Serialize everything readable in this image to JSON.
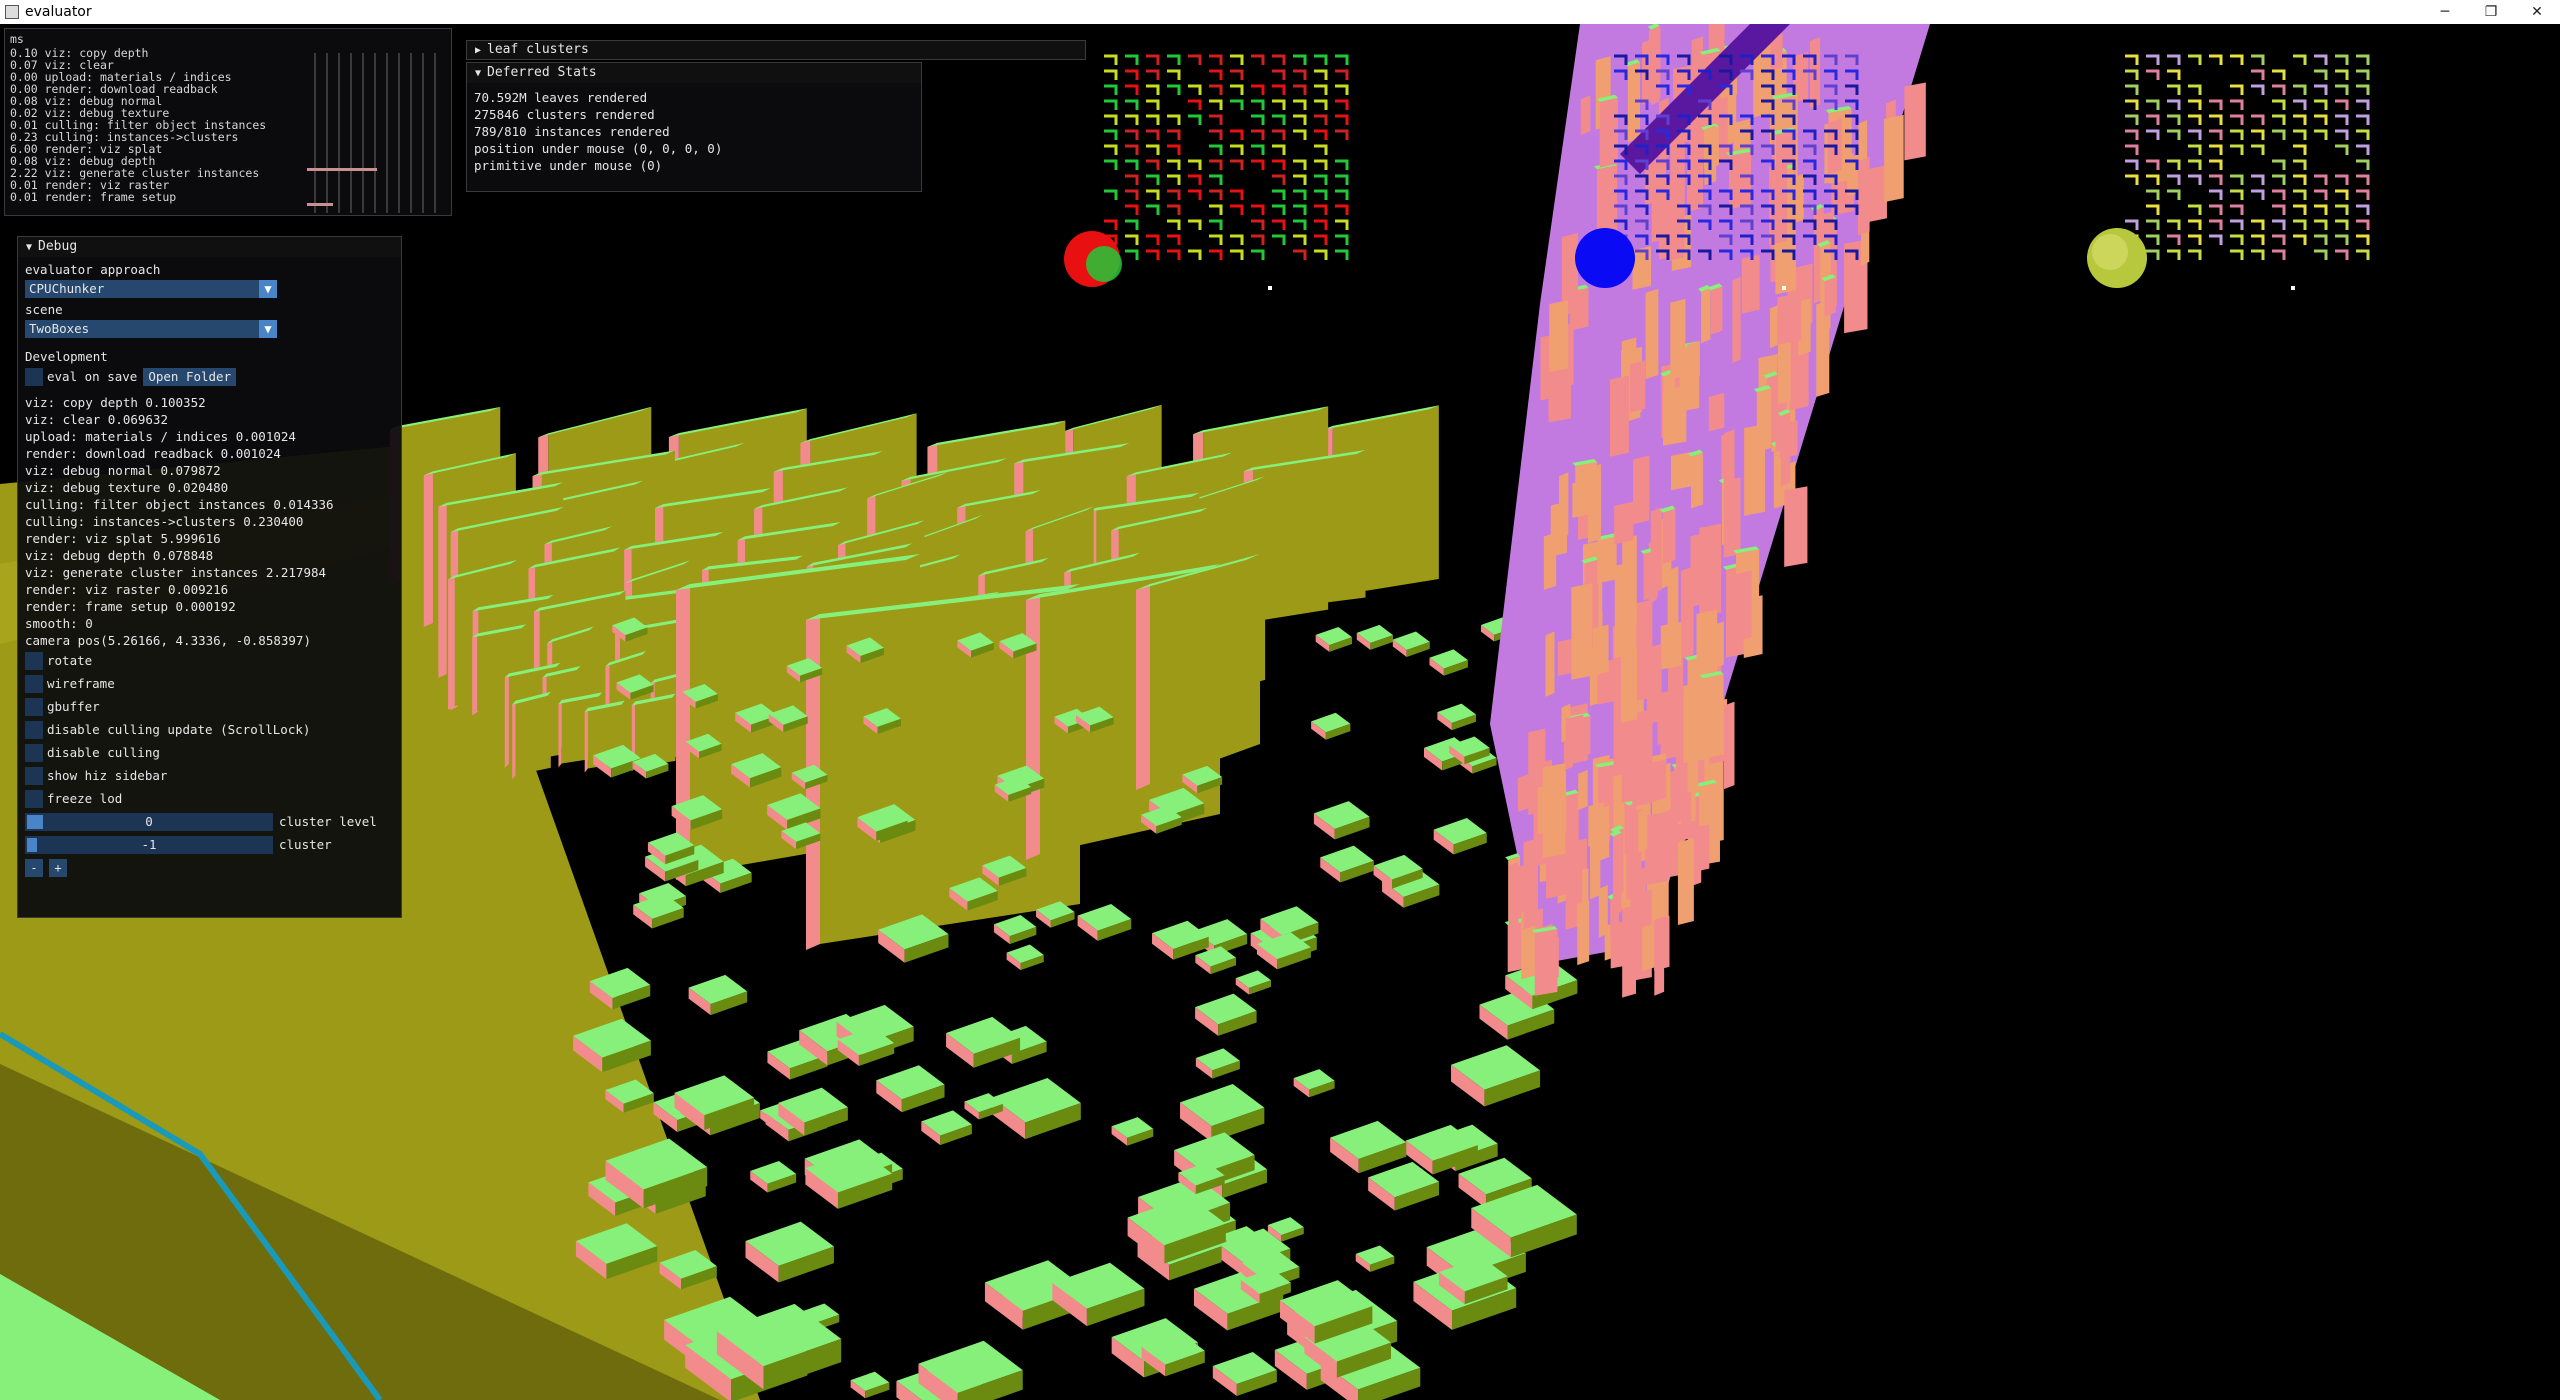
{
  "window": {
    "title": "evaluator",
    "minimize": "─",
    "maximize": "❐",
    "close": "✕"
  },
  "timing_panel": {
    "header": "ms",
    "lines": [
      "0.10 viz: copy depth",
      "0.07 viz: clear",
      "0.00 upload: materials / indices",
      "0.00 render: download readback",
      "0.08 viz: debug normal",
      "0.02 viz: debug texture",
      "0.01 culling: filter object instances",
      "0.23 culling: instances->clusters",
      "6.00 render: viz splat",
      "0.08 viz: debug depth",
      "2.22 viz: generate cluster instances",
      "0.01 render: viz raster",
      "0.01 render: frame setup"
    ]
  },
  "leaf_clusters": {
    "title": "leaf clusters"
  },
  "deferred_stats": {
    "title": "Deferred Stats",
    "lines": [
      "70.592M leaves rendered",
      "275846 clusters rendered",
      "789/810 instances rendered",
      "position under mouse (0, 0, 0, 0)",
      "primitive under mouse (0)"
    ]
  },
  "debug": {
    "title": "Debug",
    "approach_label": "evaluator approach",
    "approach_value": "CPUChunker",
    "scene_label": "scene",
    "scene_value": "TwoBoxes",
    "development_label": "Development",
    "eval_on_save": "eval on save",
    "open_folder": "Open Folder",
    "stats": [
      "viz: copy depth 0.100352",
      "viz: clear 0.069632",
      "upload: materials / indices 0.001024",
      "render: download readback 0.001024",
      "viz: debug normal 0.079872",
      "viz: debug texture 0.020480",
      "culling: filter object instances 0.014336",
      "culling: instances->clusters 0.230400",
      "render: viz splat 5.999616",
      "viz: debug depth 0.078848",
      "viz: generate cluster instances 2.217984",
      "render: viz raster 0.009216",
      "render: frame setup 0.000192",
      "smooth: 0",
      "camera pos(5.26166, 4.3336, -0.858397)"
    ],
    "checkboxes": [
      "rotate",
      "wireframe",
      "gbuffer",
      "disable culling update (ScrollLock)",
      "disable culling",
      "show hiz sidebar",
      "freeze lod"
    ],
    "cluster_level": {
      "value": "0",
      "label": "cluster level"
    },
    "cluster": {
      "value": "-1",
      "label": "cluster"
    },
    "minus": "-",
    "plus": "+"
  },
  "colors": {
    "olive": "#9c9a16",
    "olive_dark": "#6e6c0c",
    "green": "#86f07a",
    "pink": "#f28c8c",
    "violet": "#c27ae0",
    "blue": "#0a0af5",
    "red": "#e81010",
    "yellow_green": "#c8dc46"
  }
}
